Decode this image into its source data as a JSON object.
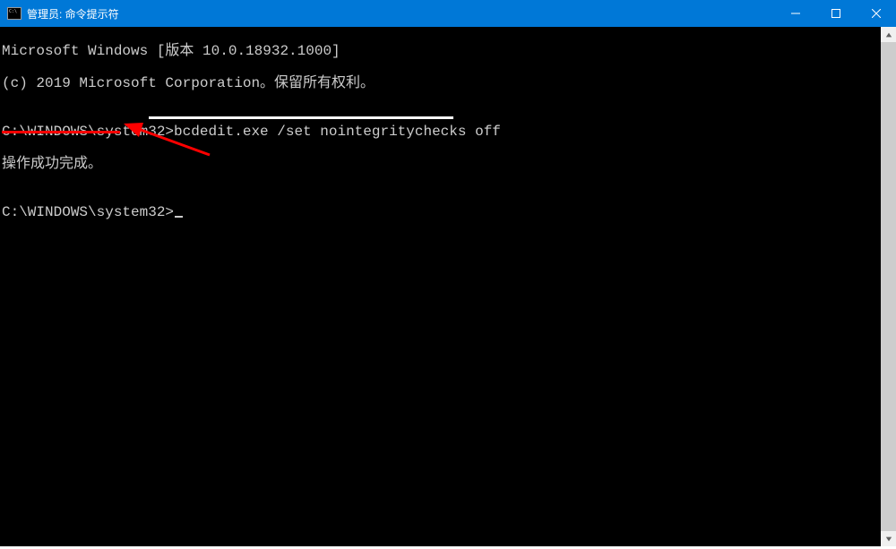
{
  "window": {
    "title": "管理员: 命令提示符"
  },
  "terminal": {
    "line1": "Microsoft Windows [版本 10.0.18932.1000]",
    "line2": "(c) 2019 Microsoft Corporation。保留所有权利。",
    "blank": "",
    "prompt": "C:\\WINDOWS\\system32>",
    "command": "bcdedit.exe /set nointegritychecks off",
    "result": "操作成功完成。"
  },
  "colors": {
    "titlebar_bg": "#0078d7",
    "terminal_bg": "#000000",
    "terminal_fg": "#cccccc",
    "annotation_red": "#ff0000",
    "annotation_white": "#ffffff"
  }
}
